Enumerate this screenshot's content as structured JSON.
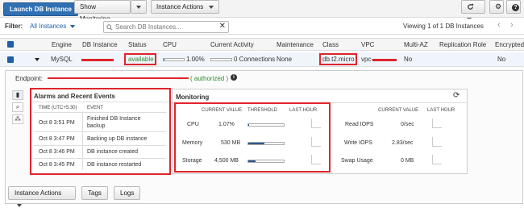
{
  "toolbar": {
    "launch_label": "Launch DB Instance",
    "show_monitoring_label": "Show Monitoring",
    "instance_actions_label": "Instance Actions"
  },
  "filter": {
    "label": "Filter:",
    "selected": "All Instances",
    "search_placeholder": "Search DB Instances...",
    "viewing": "Viewing 1 of 1 DB Instances"
  },
  "columns": [
    "Engine",
    "DB Instance",
    "Status",
    "CPU",
    "Current Activity",
    "Maintenance",
    "Class",
    "VPC",
    "Multi-AZ",
    "Replication Role",
    "Encrypted"
  ],
  "instance": {
    "engine": "MySQL",
    "status": "available",
    "cpu": "1.00%",
    "cpu_fraction": 0.01,
    "activity": "0 Connections",
    "maintenance": "None",
    "class": "db.t2.micro",
    "vpc_prefix": "vpc-",
    "multi_az": "No",
    "encrypted": "No"
  },
  "endpoint": {
    "label": "Endpoint:",
    "authorized": "( authorized )"
  },
  "alarms": {
    "title": "Alarms and Recent Events",
    "time_header": "TIME (UTC+5:30)",
    "event_header": "EVENT",
    "events": [
      {
        "time": "Oct 8 3:51 PM",
        "event": "Finished DB Instance backup"
      },
      {
        "time": "Oct 8 3:47 PM",
        "event": "Backing up DB instance"
      },
      {
        "time": "Oct 8 3:46 PM",
        "event": "DB instance created"
      },
      {
        "time": "Oct 8 3:45 PM",
        "event": "DB instance restarted"
      }
    ]
  },
  "monitoring": {
    "title": "Monitoring",
    "current_value_header": "CURRENT VALUE",
    "threshold_header": "THRESHOLD",
    "last_hour_header": "LAST HOUR",
    "left_metrics": [
      {
        "name": "CPU",
        "value": "1.07%",
        "fill": 0.01
      },
      {
        "name": "Memory",
        "value": "530 MB",
        "fill": 0.45
      },
      {
        "name": "Storage",
        "value": "4,500 MB",
        "fill": 0.2
      }
    ],
    "right_metrics": [
      {
        "name": "Read IOPS",
        "value": "0/sec"
      },
      {
        "name": "Write IOPS",
        "value": "2.83/sec"
      },
      {
        "name": "Swap Usage",
        "value": "0 MB"
      }
    ]
  },
  "bottom": {
    "instance_actions_label": "Instance Actions",
    "tags_label": "Tags",
    "logs_label": "Logs"
  }
}
